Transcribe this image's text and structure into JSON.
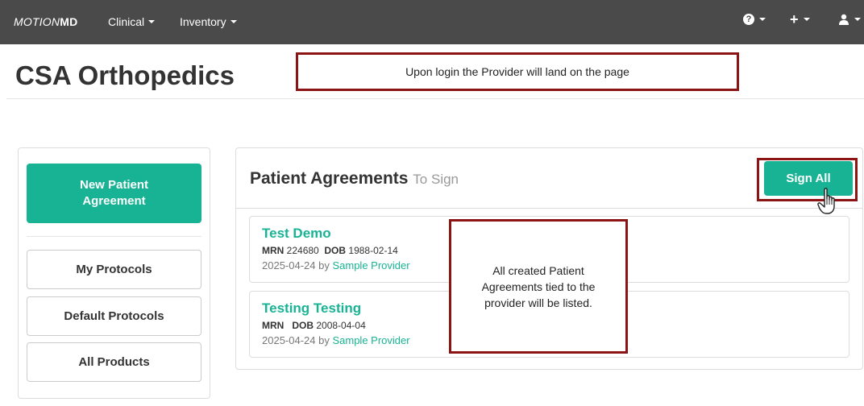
{
  "navbar": {
    "brand_part1": "MOTION",
    "brand_part2": "MD",
    "menu_clinical": "Clinical",
    "menu_inventory": "Inventory",
    "help_icon": "question-circle-icon",
    "add_icon": "plus-icon",
    "user_icon": "user-icon"
  },
  "page": {
    "title": "CSA Orthopedics"
  },
  "annotations": {
    "login_note": "Upon login the Provider will land on the page",
    "list_note": "All created Patient Agreements tied to the provider will be listed."
  },
  "sidebar": {
    "new_agreement": "New Patient Agreement",
    "items": [
      "My Protocols",
      "Default Protocols",
      "All Products"
    ]
  },
  "main": {
    "heading": "Patient Agreements",
    "heading_sub": "To Sign",
    "sign_all_label": "Sign All",
    "agreements": [
      {
        "name": "Test Demo",
        "mrn_label": "MRN",
        "mrn_value": "224680",
        "dob_label": "DOB",
        "dob_value": "1988-02-14",
        "date": "2025-04-24 by",
        "provider": "Sample Provider"
      },
      {
        "name": "Testing Testing",
        "mrn_label": "MRN",
        "mrn_value": "",
        "dob_label": "DOB",
        "dob_value": "2008-04-04",
        "date": "2025-04-24 by",
        "provider": "Sample Provider"
      }
    ]
  },
  "colors": {
    "accent": "#18b394",
    "navbar": "#4a4a4a",
    "annotation_border": "#8b1515"
  }
}
